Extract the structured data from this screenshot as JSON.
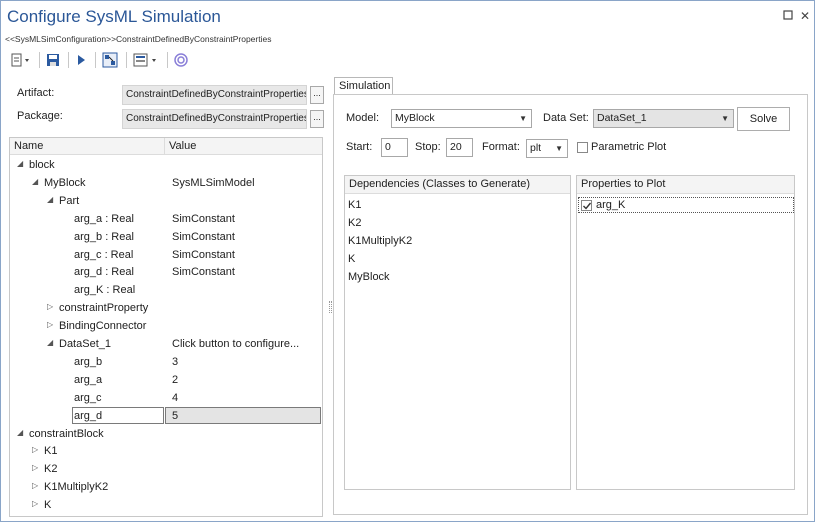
{
  "window": {
    "title": "Configure SysML Simulation",
    "subtitle": "<<SysMLSimConfiguration>>ConstraintDefinedByConstraintProperties",
    "pin_glyph": "⬜",
    "close_glyph": "✕"
  },
  "toolbar": {
    "new_dropdown_icon": "document-dropdown-icon",
    "save_icon": "save-icon",
    "run_icon": "play-icon",
    "configure_icon": "configure-icon",
    "export_icon": "export-dropdown-icon",
    "target_icon": "target-icon"
  },
  "artifact": {
    "label": "Artifact:",
    "value": "ConstraintDefinedByConstraintProperties",
    "browse": "..."
  },
  "package": {
    "label": "Package:",
    "value": "ConstraintDefinedByConstraintProperties",
    "browse": "..."
  },
  "grid": {
    "col_name": "Name",
    "col_value": "Value",
    "rows": [
      {
        "name": "block",
        "value": "",
        "level": 0,
        "tri": "◢"
      },
      {
        "name": "MyBlock",
        "value": "SysMLSimModel",
        "level": 1,
        "tri": "◢"
      },
      {
        "name": "Part",
        "value": "",
        "level": 2,
        "tri": "◢"
      },
      {
        "name": "arg_a : Real",
        "value": "SimConstant",
        "level": 3,
        "tri": ""
      },
      {
        "name": "arg_b : Real",
        "value": "SimConstant",
        "level": 3,
        "tri": ""
      },
      {
        "name": "arg_c : Real",
        "value": "SimConstant",
        "level": 3,
        "tri": ""
      },
      {
        "name": "arg_d : Real",
        "value": "SimConstant",
        "level": 3,
        "tri": ""
      },
      {
        "name": "arg_K : Real",
        "value": "",
        "level": 3,
        "tri": ""
      },
      {
        "name": "constraintProperty",
        "value": "",
        "level": 2,
        "tri": "▷"
      },
      {
        "name": "BindingConnector",
        "value": "",
        "level": 2,
        "tri": "▷"
      },
      {
        "name": "DataSet_1",
        "value": "Click button to configure...",
        "level": 2,
        "tri": "◢"
      },
      {
        "name": "arg_b",
        "value": "3",
        "level": 3,
        "tri": ""
      },
      {
        "name": "arg_a",
        "value": "2",
        "level": 3,
        "tri": ""
      },
      {
        "name": "arg_c",
        "value": "4",
        "level": 3,
        "tri": ""
      },
      {
        "name": "arg_d",
        "value": "5",
        "level": 3,
        "tri": "",
        "selected": true
      },
      {
        "name": "constraintBlock",
        "value": "",
        "level": 0,
        "tri": "◢"
      },
      {
        "name": "K1",
        "value": "",
        "level": 1,
        "tri": "▷"
      },
      {
        "name": "K2",
        "value": "",
        "level": 1,
        "tri": "▷"
      },
      {
        "name": "K1MultiplyK2",
        "value": "",
        "level": 1,
        "tri": "▷"
      },
      {
        "name": "K",
        "value": "",
        "level": 1,
        "tri": "▷"
      }
    ]
  },
  "simulation": {
    "tab_label": "Simulation",
    "model_label": "Model:",
    "model_value": "MyBlock",
    "dataset_label": "Data Set:",
    "dataset_value": "DataSet_1",
    "solve_label": "Solve",
    "start_label": "Start:",
    "start_value": "0",
    "stop_label": "Stop:",
    "stop_value": "20",
    "format_label": "Format:",
    "format_value": "plt",
    "parametric_label": "Parametric Plot",
    "parametric_checked": false,
    "dependencies_header": "Dependencies (Classes to Generate)",
    "dependencies": [
      "K1",
      "K2",
      "K1MultiplyK2",
      "K",
      "MyBlock"
    ],
    "properties_header": "Properties to Plot",
    "properties": [
      {
        "name": "arg_K",
        "checked": true
      }
    ],
    "dropdown_glyph": "▼"
  }
}
